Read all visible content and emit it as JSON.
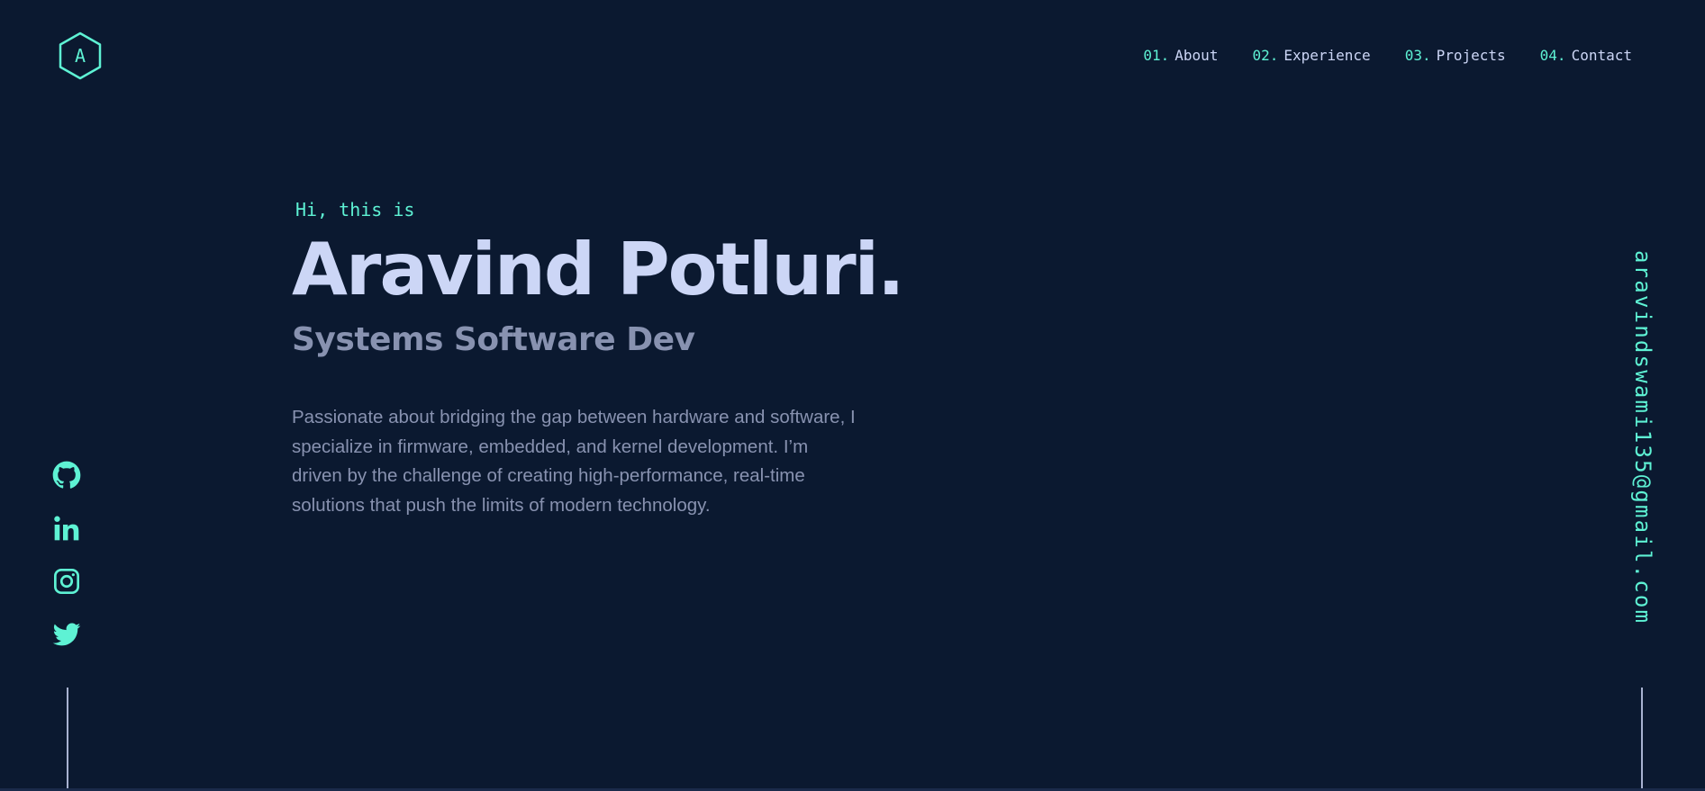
{
  "logo": {
    "letter": "A"
  },
  "nav": {
    "items": [
      {
        "number": "01.",
        "label": "About"
      },
      {
        "number": "02.",
        "label": "Experience"
      },
      {
        "number": "03.",
        "label": "Projects"
      },
      {
        "number": "04.",
        "label": "Contact"
      }
    ]
  },
  "hero": {
    "greeting": "Hi, this is",
    "name": "Aravind Potluri.",
    "role": "Systems Software Dev",
    "bio": "Passionate about bridging the gap between hardware and software, I specialize in firmware, embedded, and kernel development. I’m driven by the challenge of creating high-performance, real-time solutions that push the limits of modern technology."
  },
  "socials": [
    {
      "icon": "github-icon"
    },
    {
      "icon": "linkedin-icon"
    },
    {
      "icon": "instagram-icon"
    },
    {
      "icon": "twitter-icon"
    }
  ],
  "email": "aravindswami135@gmail.com",
  "colors": {
    "background": "#0b1930",
    "accent": "#5ef2d4",
    "heading": "#ccd6f6",
    "text": "#8892b0"
  }
}
